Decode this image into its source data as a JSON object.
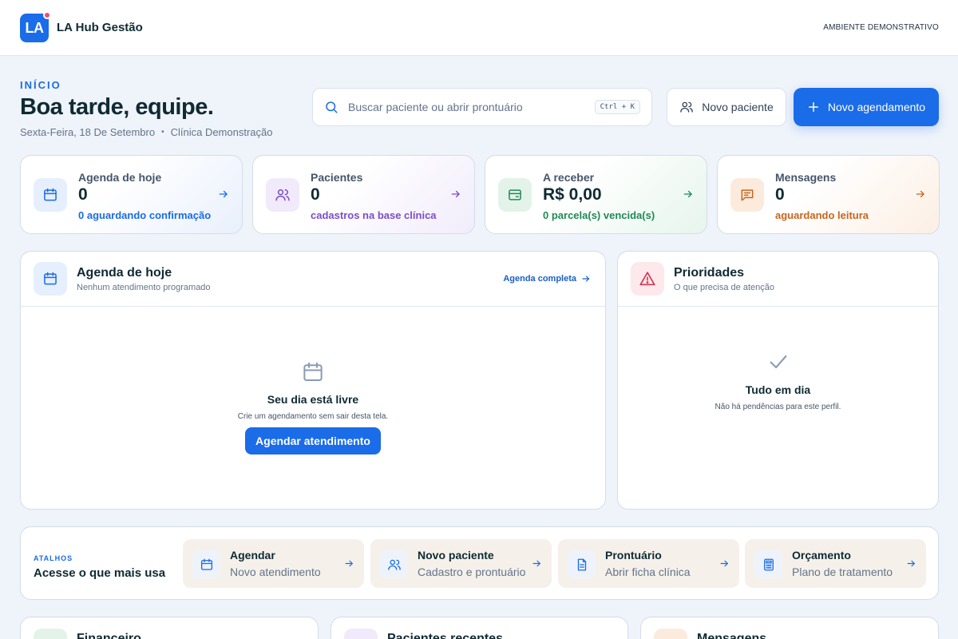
{
  "app": {
    "logo_text": "LA",
    "name": "LA Hub Gestão",
    "environment": "AMBIENTE DEMONSTRATIVO"
  },
  "header": {
    "eyebrow": "INÍCIO",
    "greeting": "Boa tarde, equipe.",
    "date": "Sexta-Feira, 18 De Setembro",
    "clinic": "Clínica Demonstração"
  },
  "search": {
    "placeholder": "Buscar paciente ou abrir prontuário",
    "shortcut": "Ctrl + K"
  },
  "actions": {
    "new_patient": "Novo paciente",
    "new_appointment": "Novo agendamento"
  },
  "stats": [
    {
      "label": "Agenda de hoje",
      "value": "0",
      "sub": "0 aguardando confirmação",
      "color": "#1a6ce8",
      "icon": "calendar-icon"
    },
    {
      "label": "Pacientes",
      "value": "0",
      "sub": "cadastros na base clínica",
      "color": "#7c4dcc",
      "icon": "users-icon"
    },
    {
      "label": "A receber",
      "value": "R$ 0,00",
      "sub": "0 parcela(s) vencida(s)",
      "color": "#1f8a55",
      "icon": "wallet-icon"
    },
    {
      "label": "Mensagens",
      "value": "0",
      "sub": "aguardando leitura",
      "color": "#c8661e",
      "icon": "message-icon"
    }
  ],
  "agenda_card": {
    "title": "Agenda de hoje",
    "desc": "Nenhum atendimento programado",
    "link": "Agenda completa",
    "empty_title": "Seu dia está livre",
    "empty_desc": "Crie um agendamento sem sair desta tela.",
    "cta": "Agendar atendimento"
  },
  "priorities_card": {
    "title": "Prioridades",
    "desc": "O que precisa de atenção",
    "empty_title": "Tudo em dia",
    "empty_desc": "Não há pendências para este perfil."
  },
  "shortcuts": {
    "eyebrow": "ATALHOS",
    "title": "Acesse o que mais usa",
    "items": [
      {
        "title": "Agendar",
        "sub": "Novo atendimento",
        "icon": "calendar-icon"
      },
      {
        "title": "Novo paciente",
        "sub": "Cadastro e prontuário",
        "icon": "users-icon"
      },
      {
        "title": "Prontuário",
        "sub": "Abrir ficha clínica",
        "icon": "document-icon"
      },
      {
        "title": "Orçamento",
        "sub": "Plano de tratamento",
        "icon": "calculator-icon"
      }
    ]
  },
  "bottom_cards": [
    {
      "title": "Financeiro"
    },
    {
      "title": "Pacientes recentes"
    },
    {
      "title": "Mensagens"
    }
  ]
}
